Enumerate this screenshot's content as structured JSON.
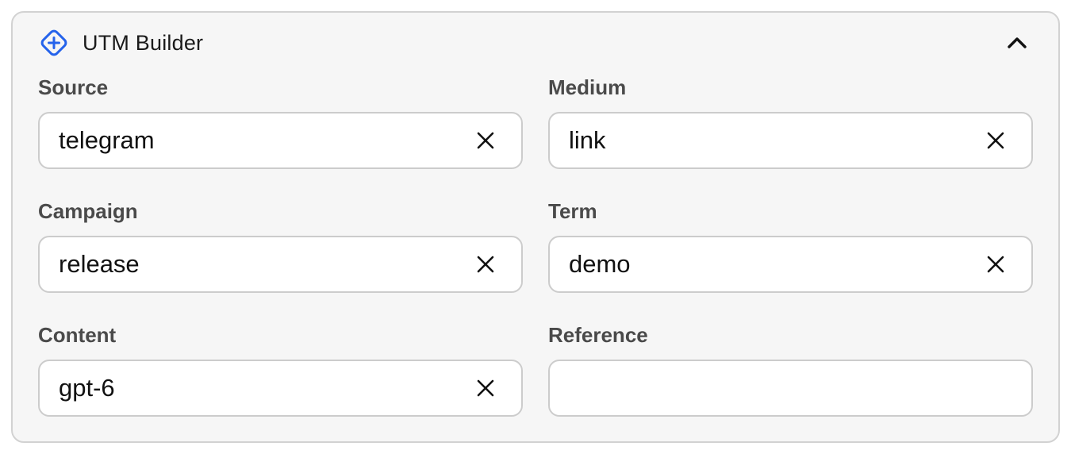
{
  "header": {
    "title": "UTM Builder",
    "icon": "plus-diamond-icon",
    "accent_color": "#2563eb",
    "collapse_icon": "chevron-up-icon"
  },
  "fields": [
    {
      "label": "Source",
      "value": "telegram",
      "clear_icon": "close-icon"
    },
    {
      "label": "Medium",
      "value": "link",
      "clear_icon": "close-icon"
    },
    {
      "label": "Campaign",
      "value": "release",
      "clear_icon": "close-icon"
    },
    {
      "label": "Term",
      "value": "demo",
      "clear_icon": "close-icon"
    },
    {
      "label": "Content",
      "value": "gpt-6",
      "clear_icon": "close-icon"
    },
    {
      "label": "Reference",
      "value": ""
    }
  ]
}
